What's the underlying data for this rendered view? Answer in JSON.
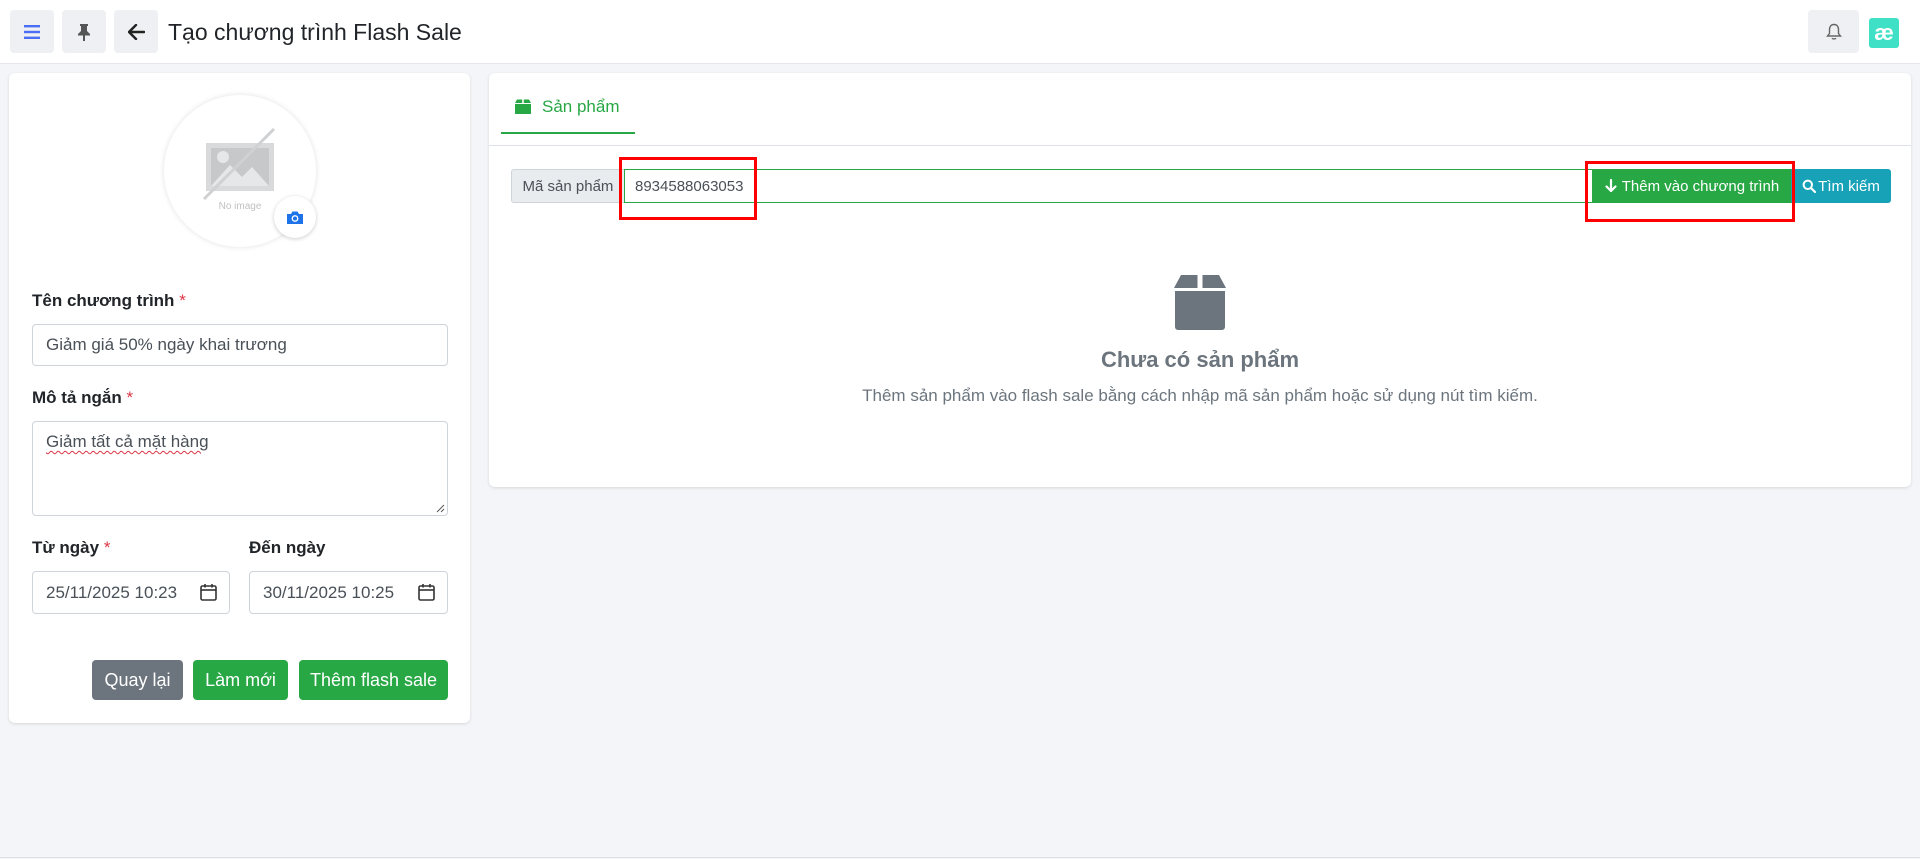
{
  "header": {
    "title": "Tạo chương trình Flash Sale",
    "menu_icon": "hamburger-icon",
    "pin_icon": "pin-icon",
    "back_icon": "arrow-left-icon",
    "bell_icon": "bell-icon",
    "logo_text": "æ"
  },
  "image_upload": {
    "placeholder_text": "No image",
    "camera_icon": "camera-icon"
  },
  "form": {
    "name_label": "Tên chương trình",
    "name_value": "Giảm giá 50% ngày khai trương",
    "desc_label": "Mô tả ngắn",
    "desc_value": "Giảm tất cả mặt hàng",
    "from_label": "Từ ngày",
    "from_value": "25/11/2025 10:23",
    "to_label": "Đến ngày",
    "to_value": "30/11/2025 10:25",
    "required_mark": "*"
  },
  "actions": {
    "back_label": "Quay lại",
    "reset_label": "Làm mới",
    "submit_label": "Thêm flash sale"
  },
  "products": {
    "tab_label": "Sản phẩm",
    "code_prefix": "Mã sản phẩm",
    "code_value": "8934588063053",
    "add_label": "Thêm vào chương trình",
    "search_label": "Tìm kiếm",
    "empty_title": "Chưa có sản phẩm",
    "empty_desc": "Thêm sản phẩm vào flash sale bằng cách nhập mã sản phẩm hoặc sử dụng nút tìm kiếm."
  },
  "colors": {
    "primary_green": "#28a745",
    "info_teal": "#17a2b8",
    "secondary_gray": "#6c757d",
    "highlight_red": "#ff0000"
  }
}
